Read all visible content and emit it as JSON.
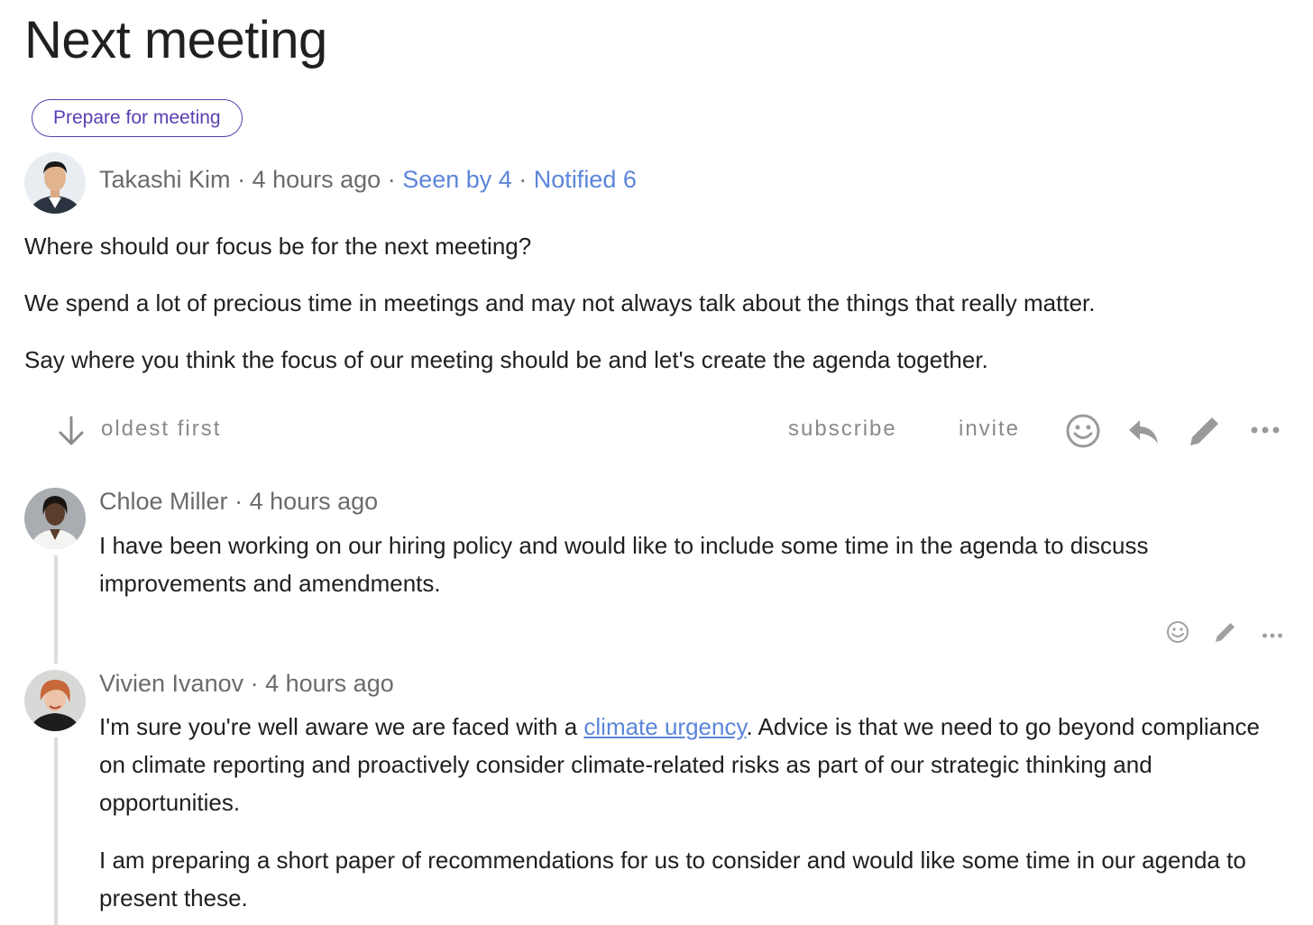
{
  "page": {
    "title": "Next meeting",
    "prepare_button": "Prepare for meeting"
  },
  "post": {
    "author": "Takashi Kim",
    "time": "4 hours ago",
    "seen": "Seen by 4",
    "notified": "Notified 6",
    "paragraphs": [
      "Where should our focus be for the next meeting?",
      "We spend a lot of precious time in meetings and may not always talk about the things that really matter.",
      "Say where you think the focus of our meeting should be and let's create the agenda together."
    ]
  },
  "toolbar": {
    "sort_label": "oldest first",
    "subscribe_label": "subscribe",
    "invite_label": "invite",
    "icons": [
      "arrow-down-icon",
      "smiley-icon",
      "reply-icon",
      "pencil-icon",
      "more-icon"
    ]
  },
  "comments": [
    {
      "author": "Chloe Miller",
      "time": "4 hours ago",
      "text": "I have been working on our hiring policy and would like to include some time in the agenda to discuss improvements and amendments."
    },
    {
      "author": "Vivien Ivanov",
      "time": "4 hours ago",
      "text_before_link": "I'm sure you're well aware we are faced with a ",
      "link_text": "climate urgency",
      "text_after_link": ". Advice is that we need to go beyond compliance on climate reporting and proactively consider climate-related risks as part of our strategic thinking and opportunities.",
      "paragraph2": "I am preparing a short paper of recommendations for us to consider and would like some time in our agenda to present these."
    }
  ],
  "colors": {
    "accent_purple": "#5a3fb0",
    "link_blue": "#5b86d9",
    "muted_gray": "#8a8a8a",
    "thread_line": "#dcdcdc"
  }
}
